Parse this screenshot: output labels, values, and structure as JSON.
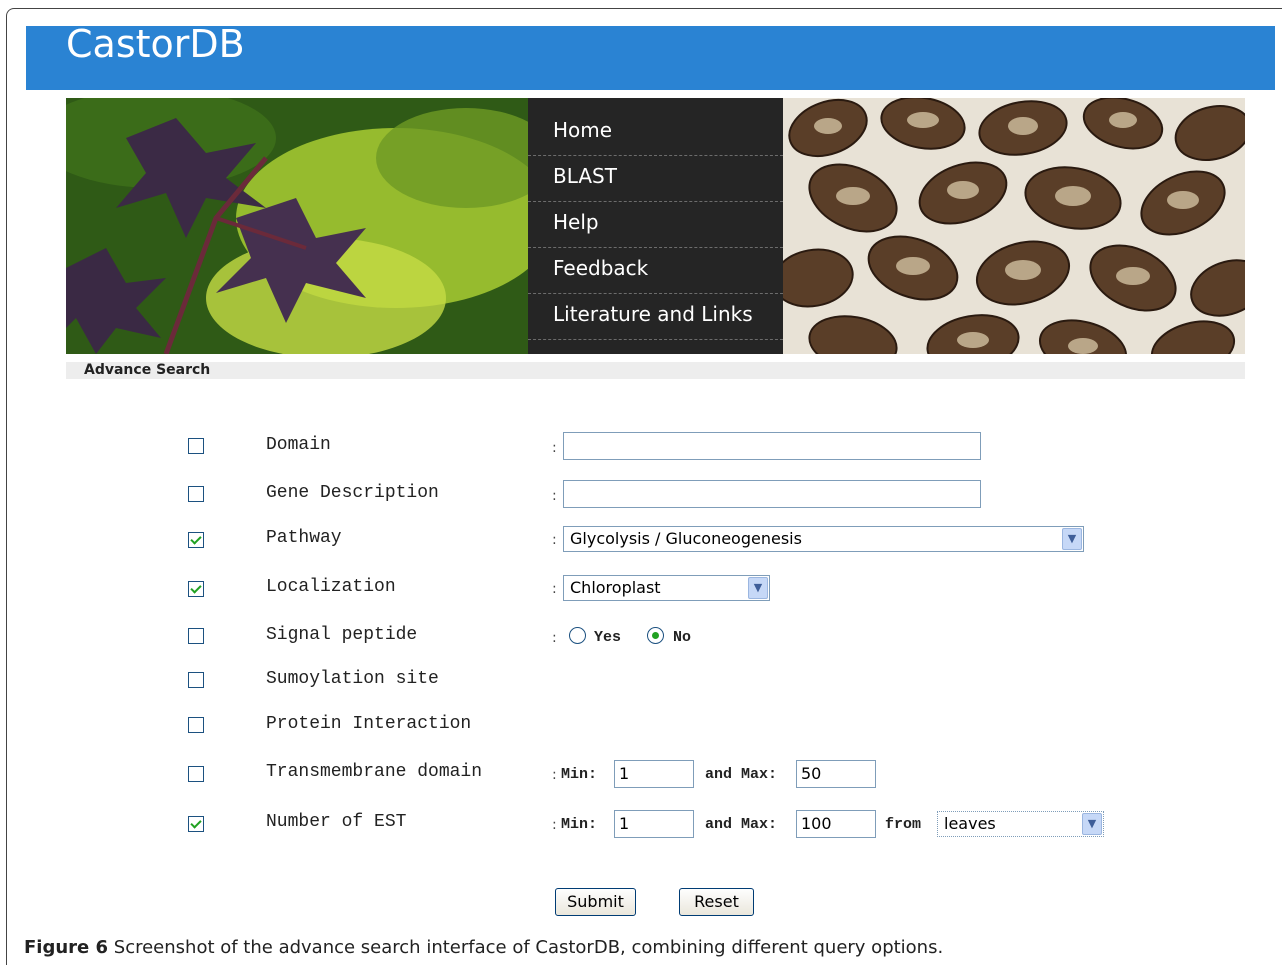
{
  "header": {
    "logo": "CastorDB"
  },
  "nav": {
    "items": [
      "Home",
      "BLAST",
      "Help",
      "Feedback",
      "Literature and Links"
    ]
  },
  "breadcrumb": "Advance Search",
  "form": {
    "rows": [
      {
        "label": "Domain",
        "checked": false
      },
      {
        "label": "Gene Description",
        "checked": false
      },
      {
        "label": "Pathway",
        "checked": true,
        "value": "Glycolysis / Gluconeogenesis"
      },
      {
        "label": "Localization",
        "checked": true,
        "value": "Chloroplast"
      },
      {
        "label": "Signal peptide",
        "checked": false,
        "radio_yes": "Yes",
        "radio_no": "No",
        "selected": "No"
      },
      {
        "label": "Sumoylation site",
        "checked": false
      },
      {
        "label": "Protein Interaction",
        "checked": false
      },
      {
        "label": "Transmembrane domain",
        "checked": false,
        "min_label": "Min:",
        "min": "1",
        "max_label": "and Max:",
        "max": "50"
      },
      {
        "label": "Number of EST",
        "checked": true,
        "min_label": "Min:",
        "min": "1",
        "max_label": "and Max:",
        "max": "100",
        "from_label": "from",
        "from": "leaves"
      }
    ],
    "colon": ":",
    "submit": "Submit",
    "reset": "Reset"
  },
  "caption": {
    "bold": "Figure 6",
    "text": " Screenshot of the advance search interface of CastorDB, combining different query options."
  }
}
